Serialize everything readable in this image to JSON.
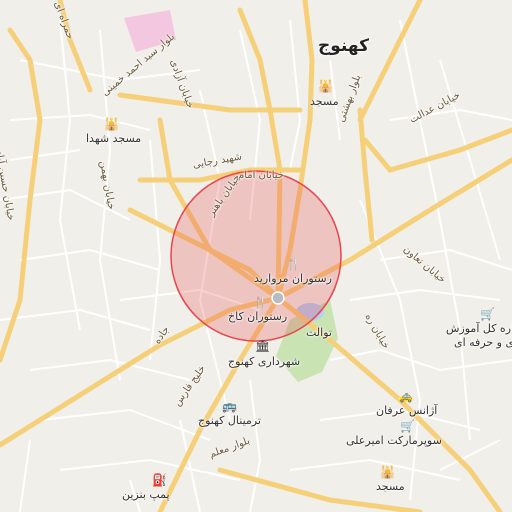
{
  "map": {
    "city": "کهنوج",
    "search_radius_circle": {
      "color": "#e8454d"
    },
    "labels": {
      "rest_morvarid": "رستوران مروارید",
      "rest_kakh": "رستوران کاخ",
      "toilet": "توالت",
      "municipality": "شهرداری کهنوج",
      "terminal": "ترمینال کهنوج",
      "agency_erfan": "آژانس عرفان",
      "supermarket": "سوپرمارکت امیرعلی",
      "mosque_n": "مسجد",
      "mosque_s": "مسجد",
      "mosque_shohada": "مسجد شهدا",
      "gas_station": "پمپ بنزین",
      "school_1": "اره کل آموزش",
      "school_2": "ی و حرفه ای",
      "st_emam": "خیابان امام",
      "st_beheshti": "بلوار بهشتی",
      "st_bahonar": "خیابان باهنر",
      "st_khomeini": "بلوار سید احمد خمینی",
      "st_edalat": "خیابان عدالت",
      "st_taavon": "خیابان تعاون",
      "st_raja": "خیابان ره",
      "st_moallem": "بلوار معلم",
      "st_persian_gulf": "خلیج فارس",
      "st_azadi": "خیابان آزادی",
      "st_jahad": "جاده",
      "st_rajai": "شهید رجایی",
      "st_hosseinabad": "خیابان حسین آباد",
      "st_bahmani": "خیابان بهمن",
      "st_hamra": "حمراه ای"
    }
  }
}
